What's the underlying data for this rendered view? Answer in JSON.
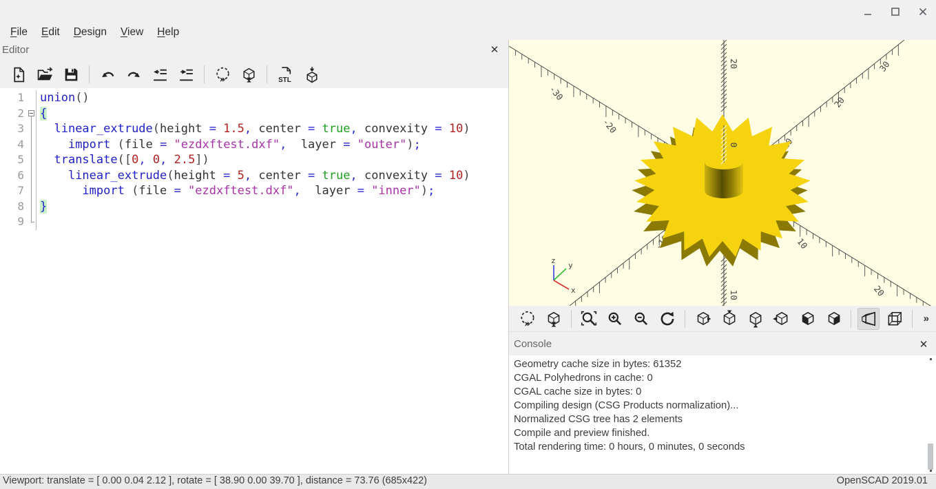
{
  "window": {
    "controls": [
      "minimize",
      "maximize",
      "close"
    ]
  },
  "menubar": {
    "items": [
      "File",
      "Edit",
      "Design",
      "View",
      "Help"
    ]
  },
  "editor": {
    "panel_title": "Editor",
    "close_glyph": "✕",
    "toolbar": [
      "new-file",
      "open",
      "save",
      "sep",
      "undo",
      "redo",
      "unindent",
      "indent",
      "sep",
      "preview",
      "render",
      "sep",
      "export-stl",
      "print-3d"
    ],
    "lines": [
      {
        "n": "1",
        "fold": "",
        "tokens": [
          [
            "kw",
            "union"
          ],
          [
            "pn",
            "()"
          ]
        ]
      },
      {
        "n": "2",
        "fold": "box",
        "tokens": [
          [
            "brace",
            "{"
          ]
        ]
      },
      {
        "n": "3",
        "fold": "line",
        "tokens": [
          [
            "id",
            "  "
          ],
          [
            "kw",
            "linear_extrude"
          ],
          [
            "pn",
            "("
          ],
          [
            "id",
            "height"
          ],
          [
            "op",
            " = "
          ],
          [
            "num",
            "1.5"
          ],
          [
            "op",
            ","
          ],
          [
            "id",
            " "
          ],
          [
            "id",
            "center"
          ],
          [
            "op",
            " = "
          ],
          [
            "bool",
            "true"
          ],
          [
            "op",
            ","
          ],
          [
            "id",
            " "
          ],
          [
            "id",
            "convexity"
          ],
          [
            "op",
            " = "
          ],
          [
            "num",
            "10"
          ],
          [
            "pn",
            ")"
          ]
        ]
      },
      {
        "n": "4",
        "fold": "line",
        "tokens": [
          [
            "id",
            "    "
          ],
          [
            "kw",
            "import"
          ],
          [
            "id",
            " "
          ],
          [
            "pn",
            "("
          ],
          [
            "id",
            "file"
          ],
          [
            "op",
            " = "
          ],
          [
            "str",
            "\"ezdxftest.dxf\""
          ],
          [
            "op",
            ","
          ],
          [
            "id",
            "  "
          ],
          [
            "id",
            "layer"
          ],
          [
            "op",
            " = "
          ],
          [
            "str",
            "\"outer\""
          ],
          [
            "pn",
            ")"
          ],
          [
            "op",
            ";"
          ]
        ]
      },
      {
        "n": "5",
        "fold": "line",
        "tokens": [
          [
            "id",
            "  "
          ],
          [
            "kw",
            "translate"
          ],
          [
            "pn",
            "(["
          ],
          [
            "num",
            "0"
          ],
          [
            "op",
            ","
          ],
          [
            "id",
            " "
          ],
          [
            "num",
            "0"
          ],
          [
            "op",
            ","
          ],
          [
            "id",
            " "
          ],
          [
            "num",
            "2.5"
          ],
          [
            "pn",
            "])"
          ]
        ]
      },
      {
        "n": "6",
        "fold": "line",
        "tokens": [
          [
            "id",
            "    "
          ],
          [
            "kw",
            "linear_extrude"
          ],
          [
            "pn",
            "("
          ],
          [
            "id",
            "height"
          ],
          [
            "op",
            " = "
          ],
          [
            "num",
            "5"
          ],
          [
            "op",
            ","
          ],
          [
            "id",
            " "
          ],
          [
            "id",
            "center"
          ],
          [
            "op",
            " = "
          ],
          [
            "bool",
            "true"
          ],
          [
            "op",
            ","
          ],
          [
            "id",
            " "
          ],
          [
            "id",
            "convexity"
          ],
          [
            "op",
            " = "
          ],
          [
            "num",
            "10"
          ],
          [
            "pn",
            ")"
          ]
        ]
      },
      {
        "n": "7",
        "fold": "line",
        "tokens": [
          [
            "id",
            "      "
          ],
          [
            "kw",
            "import"
          ],
          [
            "id",
            " "
          ],
          [
            "pn",
            "("
          ],
          [
            "id",
            "file"
          ],
          [
            "op",
            " = "
          ],
          [
            "str",
            "\"ezdxftest.dxf\""
          ],
          [
            "op",
            ","
          ],
          [
            "id",
            "  "
          ],
          [
            "id",
            "layer"
          ],
          [
            "op",
            " = "
          ],
          [
            "str",
            "\"inner\""
          ],
          [
            "pn",
            ")"
          ],
          [
            "op",
            ";"
          ]
        ]
      },
      {
        "n": "8",
        "fold": "line",
        "tokens": [
          [
            "brace",
            "}"
          ]
        ]
      },
      {
        "n": "9",
        "fold": "end",
        "tokens": []
      }
    ]
  },
  "viewport": {
    "background": "#FFFEE5",
    "gear_color": "#F6D30F",
    "gear_shadow_color": "#8A7903",
    "axes": {
      "x_labels": [
        {
          "v": "-30",
          "t": 0.1
        },
        {
          "v": "-20",
          "t": 0.225
        },
        {
          "v": "-10",
          "t": 0.35
        },
        {
          "v": "10",
          "t": 0.68
        },
        {
          "v": "20",
          "t": 0.86
        }
      ],
      "y_labels": [
        {
          "v": "-10",
          "t": 0.26
        },
        {
          "v": "10",
          "t": 0.64
        },
        {
          "v": "20",
          "t": 0.795
        },
        {
          "v": "30",
          "t": 0.93
        }
      ],
      "z_labels": [
        {
          "v": "20",
          "t": 0.07
        },
        {
          "v": "0",
          "t": 0.385
        },
        {
          "v": "10",
          "t": 0.94
        }
      ]
    },
    "axis_indicator": {
      "x": "x",
      "y": "y",
      "z": "z",
      "x_color": "#e03030",
      "y_color": "#30c030",
      "z_color": "#3040e0"
    }
  },
  "viewport_toolbar": {
    "items": [
      "preview",
      "render",
      "sep",
      "zoom-all",
      "zoom-in",
      "zoom-out",
      "reset-view",
      "sep",
      "view-right",
      "view-top",
      "view-bottom",
      "view-left",
      "view-front",
      "view-back",
      "sep",
      "perspective",
      "orthogonal",
      "sep"
    ],
    "active": "perspective",
    "overflow_glyph": "»"
  },
  "console": {
    "title": "Console",
    "close_glyph": "✕",
    "lines": [
      "Geometry cache size in bytes: 61352",
      "CGAL Polyhedrons in cache: 0",
      "CGAL cache size in bytes: 0",
      "Compiling design (CSG Products normalization)...",
      "Normalized CSG tree has 2 elements",
      "Compile and preview finished.",
      "Total rendering time: 0 hours, 0 minutes, 0 seconds"
    ]
  },
  "statusbar": {
    "left": "Viewport: translate = [ 0.00 0.04 2.12 ], rotate = [ 38.90 0.00 39.70 ], distance = 73.76 (685x422)",
    "right": "OpenSCAD 2019.01"
  }
}
